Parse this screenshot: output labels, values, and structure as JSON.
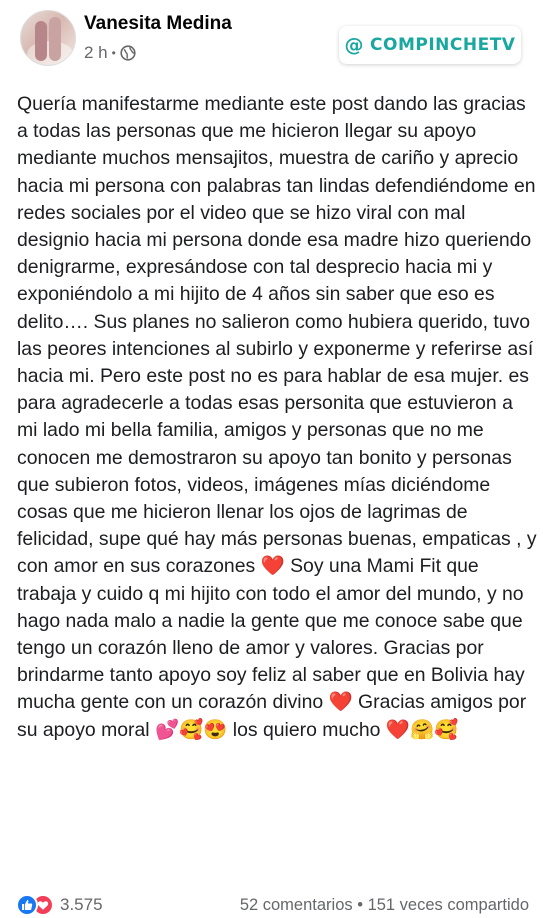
{
  "post": {
    "author": "Vanesita Medina",
    "time": "2 h",
    "separator": "•",
    "text": "Quería manifestarme mediante este post dando las gracias a todas las personas que me hicieron llegar su apoyo mediante muchos mensajitos, muestra de cariño y aprecio hacia mi persona con palabras tan lindas defendiéndome en redes sociales  por el video que se hizo viral con mal designio hacia mi persona donde esa madre hizo queriendo denigrarme, expresándose con tal desprecio hacia mi y exponiéndolo a mi hijito de 4 años sin saber que eso es delito…. Sus planes no salieron como hubiera querido, tuvo las peores intenciones al subirlo y exponerme  y referirse así hacia mi. Pero este post no es para hablar de esa mujer. es para agradecerle a todas esas personita que estuvieron a mi lado mi bella familia, amigos y personas que no me conocen me demostraron su apoyo tan bonito y personas que subieron fotos, videos, imágenes mías diciéndome cosas que me hicieron llenar los ojos de lagrimas de felicidad, supe qué hay más personas buenas, empaticas , y con amor en sus corazones ❤️ Soy una Mami Fit que trabaja y cuido q mi hijito con todo el amor del mundo, y no hago nada malo a nadie la gente que me conoce sabe que tengo un corazón lleno de amor y valores. Gracias por brindarme tanto apoyo soy feliz al saber que en Bolivia hay mucha gente con un corazón divino  ❤️  Gracias amigos por su apoyo moral 💕🥰😍 los quiero mucho ❤️🤗🥰"
  },
  "watermark": {
    "at": "@",
    "label": "COMPINCHETV"
  },
  "footer": {
    "reaction_count": "3.575",
    "stats": "52 comentarios • 151 veces compartido"
  },
  "colors": {
    "accent_like": "#1877f2",
    "accent_love": "#f33e58",
    "watermark": "#1aa7a0",
    "secondary_text": "#65676b"
  },
  "icons": [
    "globe-icon",
    "like-icon",
    "love-icon"
  ]
}
